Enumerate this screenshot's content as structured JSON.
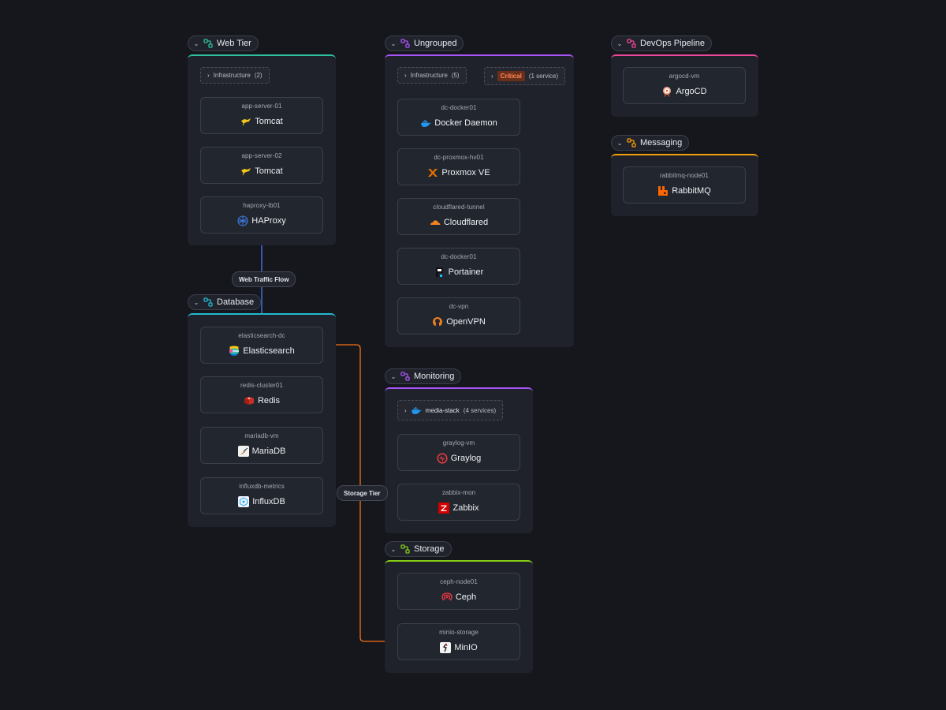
{
  "colors": {
    "background": "#16161d",
    "panel": "#1f222a",
    "web_accent": "#2dbf9e",
    "ungrouped_accent": "#a855f7",
    "devops_accent": "#ec4899",
    "messaging_accent": "#f59e0b",
    "database_accent": "#22b8cf",
    "monitoring_accent": "#a855f7",
    "storage_accent": "#84cc16",
    "web_edge": "#3b6fd8",
    "storage_edge": "#f97316"
  },
  "groups": {
    "web": {
      "title": "Web Tier",
      "collapsed": "Infrastructure",
      "collapsed_count": "(2)",
      "nodes": [
        {
          "host": "app-server-01",
          "service": "Tomcat",
          "icon": "tomcat-icon"
        },
        {
          "host": "app-server-02",
          "service": "Tomcat",
          "icon": "tomcat-icon"
        },
        {
          "host": "haproxy-lb01",
          "service": "HAProxy",
          "icon": "haproxy-icon"
        }
      ]
    },
    "ungrouped": {
      "title": "Ungrouped",
      "collapsed": "Infrastructure",
      "collapsed_count": "(5)",
      "critical_badge": "Critical",
      "critical_count": "(1 service)",
      "nodes": [
        {
          "host": "dc-docker01",
          "service": "Docker Daemon",
          "icon": "docker-icon"
        },
        {
          "host": "dc-proxmox-hv01",
          "service": "Proxmox VE",
          "icon": "proxmox-icon"
        },
        {
          "host": "cloudflared-tunnel",
          "service": "Cloudflared",
          "icon": "cloudflare-icon"
        },
        {
          "host": "dc-docker01",
          "service": "Portainer",
          "icon": "portainer-icon"
        },
        {
          "host": "dc-vpn",
          "service": "OpenVPN",
          "icon": "openvpn-icon"
        }
      ]
    },
    "devops": {
      "title": "DevOps Pipeline",
      "nodes": [
        {
          "host": "argocd-vm",
          "service": "ArgoCD",
          "icon": "argocd-icon"
        }
      ]
    },
    "messaging": {
      "title": "Messaging",
      "nodes": [
        {
          "host": "rabbitmq-node01",
          "service": "RabbitMQ",
          "icon": "rabbitmq-icon"
        }
      ]
    },
    "database": {
      "title": "Database",
      "nodes": [
        {
          "host": "elasticsearch-dc",
          "service": "Elasticsearch",
          "icon": "elasticsearch-icon"
        },
        {
          "host": "redis-cluster01",
          "service": "Redis",
          "icon": "redis-icon"
        },
        {
          "host": "mariadb-vm",
          "service": "MariaDB",
          "icon": "mariadb-icon"
        },
        {
          "host": "influxdb-metrics",
          "service": "InfluxDB",
          "icon": "influxdb-icon"
        }
      ]
    },
    "monitoring": {
      "title": "Monitoring",
      "collapsed": "media-stack",
      "collapsed_count": "(4 services)",
      "nodes": [
        {
          "host": "graylog-vm",
          "service": "Graylog",
          "icon": "graylog-icon"
        },
        {
          "host": "zabbix-mon",
          "service": "Zabbix",
          "icon": "zabbix-icon"
        }
      ]
    },
    "storage": {
      "title": "Storage",
      "nodes": [
        {
          "host": "ceph-node01",
          "service": "Ceph",
          "icon": "ceph-icon"
        },
        {
          "host": "minio-storage",
          "service": "MinIO",
          "icon": "minio-icon"
        }
      ]
    }
  },
  "edge_labels": {
    "web_traffic": "Web Traffic Flow",
    "storage_tier": "Storage Tier"
  }
}
